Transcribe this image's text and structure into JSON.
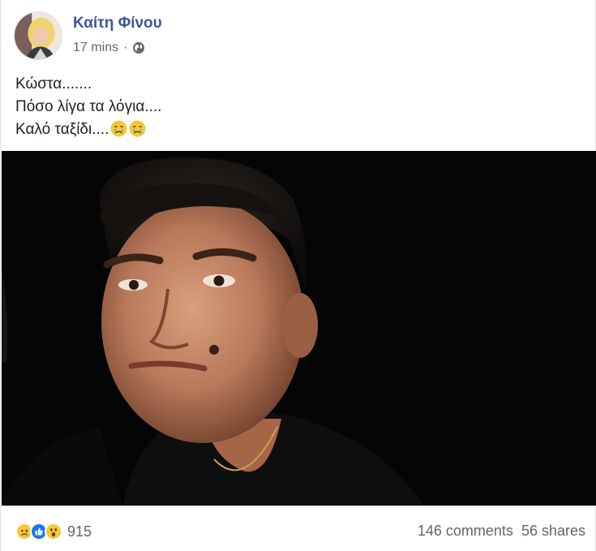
{
  "post": {
    "author": "Καίτη Φίνου",
    "timestamp": "17 mins",
    "separator": "·",
    "privacy_icon": "globe-icon",
    "text_lines": [
      "Κώστα.......",
      "Πόσο λίγα τα λόγια....",
      "Καλό ταξίδι...."
    ],
    "text_emojis": [
      "crying-face-emoji",
      "crying-face-emoji"
    ],
    "photo": "portrait-photo"
  },
  "footer": {
    "reactions": [
      "sad-reaction-icon",
      "like-reaction-icon",
      "wow-reaction-icon"
    ],
    "reaction_count": "915",
    "comments": "146 comments",
    "shares": "56 shares"
  },
  "colors": {
    "author_link": "#385898",
    "meta_text": "#606770",
    "like_blue": "#1877f2",
    "emoji_yellow": "#f7c736"
  }
}
